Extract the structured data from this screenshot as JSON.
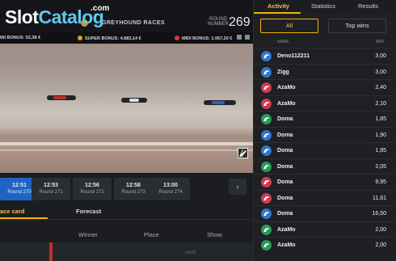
{
  "brand": {
    "slot": "Slot",
    "catalog": "Catalog",
    "com": ".com"
  },
  "header": {
    "title": "GREYHOUND RACES",
    "round_label": "ROUND\nNUMBER",
    "round_number": "269"
  },
  "bonuses": {
    "mini": "INI BONUS: 52,38 €",
    "super": "SUPER BONUS: 4.883,14 €",
    "midi": "MIDI BONUS: 1.067,20 €"
  },
  "rounds": [
    {
      "time": "12:51",
      "label": "Round 270",
      "active": true
    },
    {
      "time": "12:53",
      "label": "Round 271",
      "active": false
    },
    {
      "time": "12:56",
      "label": "Round 272",
      "active": false
    },
    {
      "time": "12:58",
      "label": "Round 273",
      "active": false
    },
    {
      "time": "13:00",
      "label": "Round 274",
      "active": false
    }
  ],
  "next_icon": "›",
  "race_tabs": {
    "race_card": "ace card",
    "forecast": "Forecast"
  },
  "race_columns": {
    "winner": "Winner",
    "place": "Place",
    "show": "Show"
  },
  "footer": {
    "brand": "nsoft"
  },
  "panel": {
    "tabs": {
      "activity": "Activity",
      "statistics": "Statistics",
      "results": "Results"
    },
    "filters": {
      "all": "All",
      "top": "Top wins"
    },
    "columns": {
      "name": "NAME",
      "win": "WIN"
    },
    "rows": [
      {
        "name": "Deno112211",
        "win": "3,00",
        "color": "#2e7ac8"
      },
      {
        "name": "Zigg",
        "win": "3,00",
        "color": "#2e7ac8"
      },
      {
        "name": "AzaMo",
        "win": "2,40",
        "color": "#d23a52"
      },
      {
        "name": "AzaMo",
        "win": "2,10",
        "color": "#d23a52"
      },
      {
        "name": "Doma",
        "win": "1,85",
        "color": "#2a9a5a"
      },
      {
        "name": "Doma",
        "win": "1,90",
        "color": "#2e7ac8"
      },
      {
        "name": "Doma",
        "win": "1,85",
        "color": "#2e7ac8"
      },
      {
        "name": "Doma",
        "win": "2,05",
        "color": "#2a9a5a"
      },
      {
        "name": "Doma",
        "win": "9,95",
        "color": "#d23a52"
      },
      {
        "name": "Doma",
        "win": "11,61",
        "color": "#d23a52"
      },
      {
        "name": "Doma",
        "win": "16,50",
        "color": "#2e7ac8"
      },
      {
        "name": "AzaMo",
        "win": "2,00",
        "color": "#2a9a5a"
      },
      {
        "name": "AzaMo",
        "win": "2,00",
        "color": "#2a9a5a"
      }
    ]
  },
  "colors": {
    "accent": "#f5b400",
    "active_round": "#1f64c4",
    "bonus_mini": "#3a8fd8",
    "bonus_super": "#e0a020",
    "bonus_midi": "#d23a3a"
  }
}
